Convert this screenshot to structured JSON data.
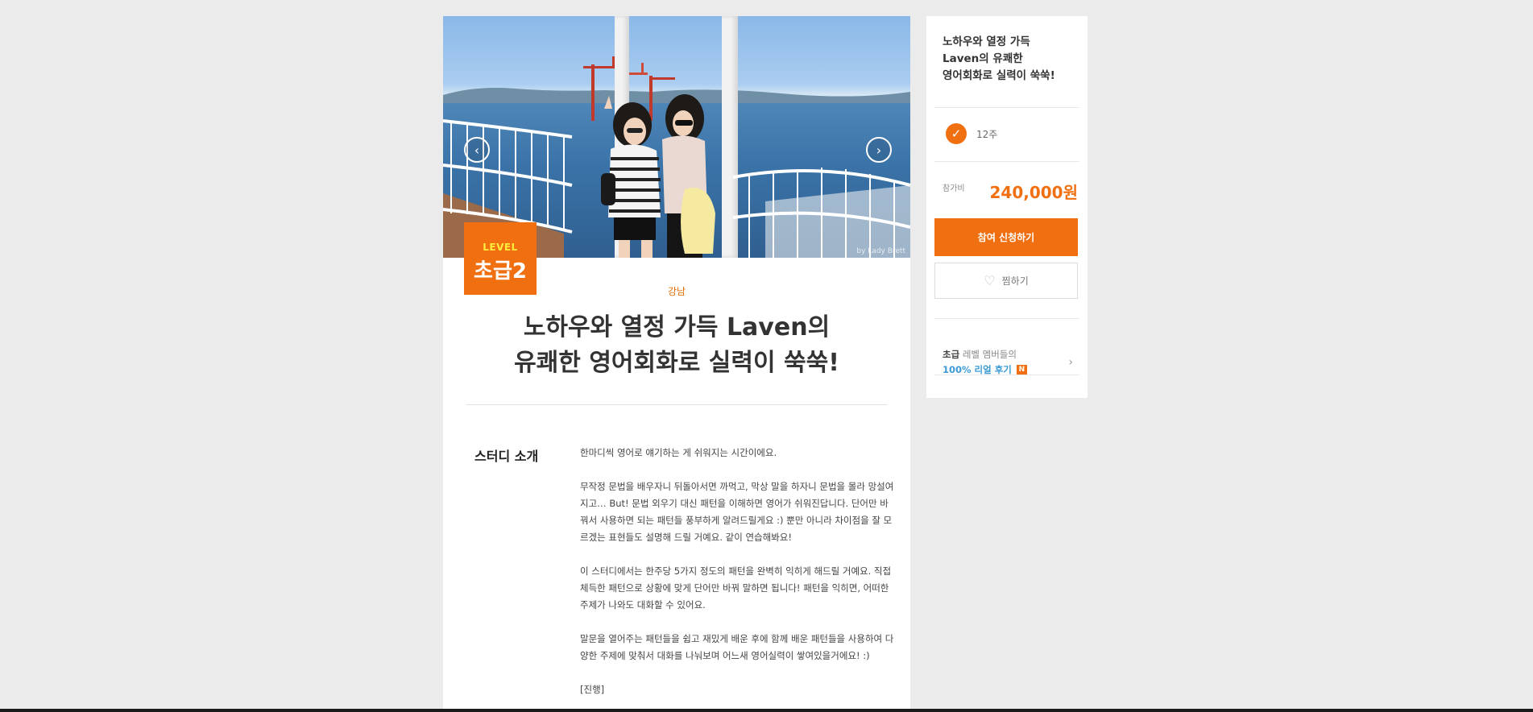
{
  "hero": {
    "prev_icon": "chevron-left-icon",
    "next_icon": "chevron-right-icon",
    "prev_glyph": "‹",
    "next_glyph": "›",
    "watermark": "by Lady Brett"
  },
  "level_badge": {
    "label": "LEVEL",
    "value": "초급2"
  },
  "location": "강남",
  "title": {
    "line1": "노하우와 열정 가득 Laven의",
    "line2": "유쾌한 영어회화로 실력이 쑥쑥!"
  },
  "intro": {
    "heading": "스터디 소개",
    "paragraphs": [
      "한마디씩 영어로 얘기하는 게 쉬워지는 시간이에요.",
      "무작정 문법을 배우자니 뒤돌아서면 까먹고, 막상 말을 하자니 문법을 몰라 망설여지고… But! 문법 외우기 대신 패턴을 이해하면 영어가 쉬워진답니다. 단어만 바꿔서 사용하면 되는 패턴들 풍부하게 알려드릴게요 :) 뿐만 아니라 차이점을 잘 모르겠는 표현들도 설명해 드릴 거예요. 같이 연습해봐요!",
      "이 스터디에서는 한주당 5가지 정도의 패턴을 완벽히 익히게 해드릴 거예요. 직접 체득한 패턴으로 상황에 맞게 단어만 바꿔 말하면 됩니다! 패턴을 익히면, 어떠한 주제가 나와도 대화할 수 있어요.",
      "말문을 열어주는 패턴들을 쉽고 재밌게 배운 후에 함께 배운 패턴들을 사용하여 다양한 주제에 맞춰서 대화를 나눠보며 어느새 영어실력이 쌓여있을거에요! :)",
      "[진행]"
    ]
  },
  "sidebar": {
    "title": {
      "line1": "노하우와 열정 가득",
      "line2": "Laven의  유쾌한",
      "line3": "영어회화로 실력이 쑥쑥!"
    },
    "duration_icon": "check-circle-icon",
    "duration": "12주",
    "fee_label": "참가비",
    "fee_value": "240,000원",
    "apply_label": "참여 신청하기",
    "wish_icon": "heart-outline-icon",
    "wish_label": "찜하기",
    "review_level": "초급",
    "review_suffix": " 레벨 멤버들의",
    "review_highlight": "100% 리얼 후기",
    "review_badge": "N",
    "review_arrow_icon": "chevron-right-icon",
    "review_arrow": "›"
  },
  "colors": {
    "accent": "#f07011",
    "level_label": "#ffec3d",
    "review_link": "#3c9bd6",
    "background": "#ebebeb"
  }
}
